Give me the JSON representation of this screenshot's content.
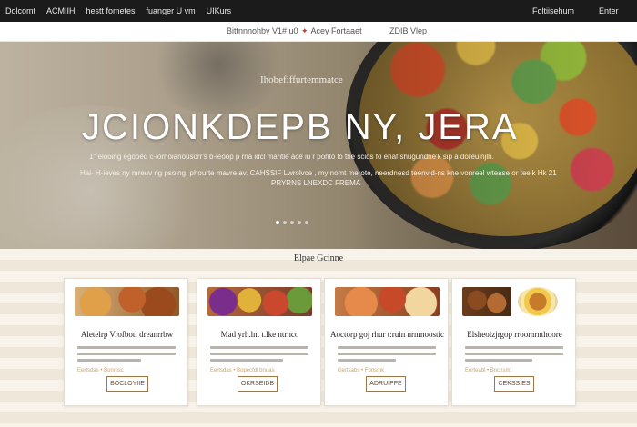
{
  "topbar": {
    "nav": [
      "Dolcomt",
      "ACMIIH",
      "hestt fometes",
      "fuanger U vm",
      "UIKurs"
    ],
    "right_link": "Foltiisehum",
    "right_link2": "Enter"
  },
  "subnav": {
    "item1": "Bittnnnohby V1# u0",
    "item2": "Acey Fortaaet",
    "item3": "ZDIB Vlep"
  },
  "hero": {
    "kicker": "Ihobefiffurtemmatce",
    "headline": "JCIONKDEPB NY, JERA",
    "desc_line1": "1\" elooing egooed c-iorhoianousorr's b-leoop p rna idcl  maritle ace iu r ponto lo the scids fo enaf shugundhe'k sip  a doreuinjlh.",
    "desc_line2": "Hai- H-ieves ny mreuv ng psoing, phourte mavre av.   CAHSSIF Lwrolvce ,  my nomt merote, neerdnesd teenvld-ns kne vonreel  wtease or teelk  Hk 21",
    "desc_line3": "PRYRNS LNEXDC FREMA",
    "slides": 5,
    "active_slide": 0
  },
  "section": {
    "title": "Elpae  Gcinne"
  },
  "cards": [
    {
      "title": "Aletelrp Vrofbotl dreanrrbw",
      "meta": "Eertsdas • Bonmsc",
      "button": "BOCLOYIIE"
    },
    {
      "title": "Mad yrh.lnt t.lke ntrnco",
      "meta": "Eertsdas • Bopecfdl bnuas",
      "button": "OKRSEIDB"
    },
    {
      "title": "Aoctorp goj rhur t:ruin nrnmoostic",
      "meta": "Gertsabs • Fbnsmk",
      "button": "ADRUIPFE"
    },
    {
      "title": "Elsheolzjrgop rroomrnthoore",
      "meta": "Eerteabl • Bncnsmf",
      "button": "CEKSSIES"
    }
  ]
}
